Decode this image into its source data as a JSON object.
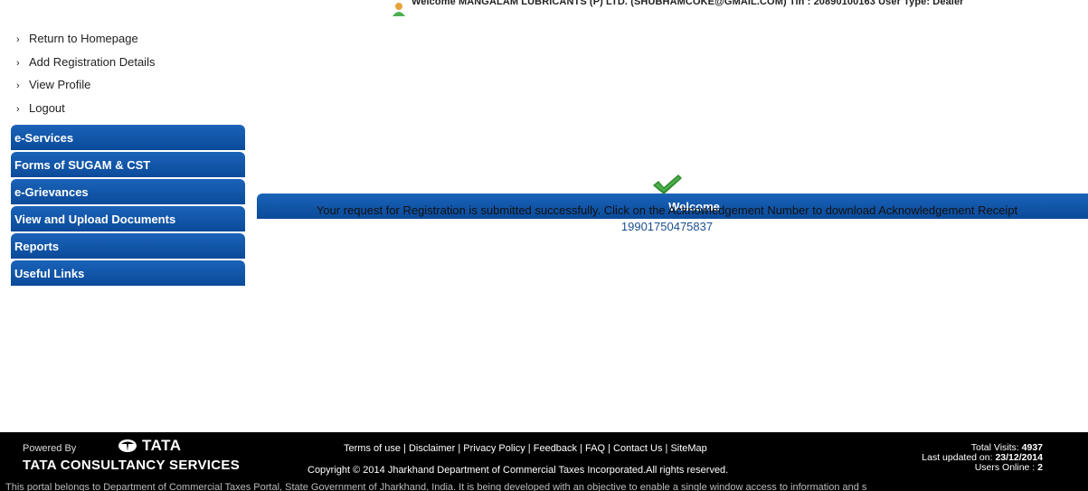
{
  "topbar": {
    "welcome_text": "Welcome MANGALAM LUBRICANTS (P) LTD. (SHUBHAMCOKE@GMAIL.COM) Tin : 20890100163 User Type: Dealer"
  },
  "sidebar": {
    "header": "Welcome",
    "links": [
      {
        "label": "Return to Homepage"
      },
      {
        "label": "Add Registration Details"
      },
      {
        "label": "View Profile"
      },
      {
        "label": "Logout"
      }
    ],
    "sections": [
      {
        "label": "e-Services"
      },
      {
        "label": "Forms of SUGAM & CST"
      },
      {
        "label": "e-Grievances"
      },
      {
        "label": "View and Upload Documents"
      },
      {
        "label": "Reports"
      },
      {
        "label": "Useful Links"
      }
    ],
    "accent_color": "#0b4a9a"
  },
  "main": {
    "message": "Your request for Registration is submitted successfully. Click on the Acknowledgement Number to download Acknowledgement Receipt",
    "ack_number": "19901750475837",
    "icon": "check-icon"
  },
  "footer": {
    "powered_by": "Powered By",
    "tata": "TATA",
    "tcs": "TATA CONSULTANCY SERVICES",
    "links": [
      "Terms of use",
      "Disclaimer",
      "Privacy Policy",
      "Feedback",
      "FAQ",
      "Contact Us",
      "SiteMap"
    ],
    "copyright": "Copyright © 2014 Jharkhand Department of Commercial Taxes Incorporated.All rights reserved.",
    "total_visits_label": "Total Visits:",
    "total_visits": "4937",
    "last_updated_label": "Last updated on:",
    "last_updated": "23/12/2014",
    "users_online_label": "Users Online :",
    "users_online": "2",
    "bottom_note": "This portal belongs to Department of Commercial Taxes Portal, State Government of Jharkhand, India. It is being developed with an objective to enable a single window access to information and s"
  }
}
